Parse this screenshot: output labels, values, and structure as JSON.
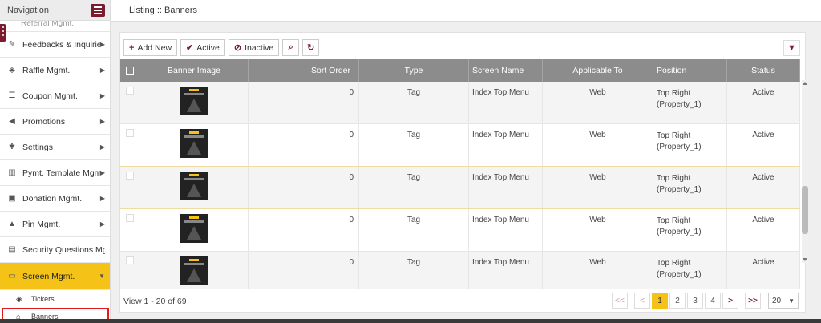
{
  "sidebar": {
    "title": "Navigation",
    "cut_item": "Referral Mgmt.",
    "items": [
      {
        "label": "Feedbacks & Inquiries",
        "icon": "edit-icon"
      },
      {
        "label": "Raffle Mgmt.",
        "icon": "ticket-icon"
      },
      {
        "label": "Coupon Mgmt.",
        "icon": "list-icon"
      },
      {
        "label": "Promotions",
        "icon": "bullhorn-icon"
      },
      {
        "label": "Settings",
        "icon": "gear-icon"
      },
      {
        "label": "Pymt. Template Mgmt.",
        "icon": "bank-icon"
      },
      {
        "label": "Donation Mgmt.",
        "icon": "money-icon"
      },
      {
        "label": "Pin Mgmt.",
        "icon": "lock-icon"
      },
      {
        "label": "Security Questions Mgmt.",
        "icon": "document-icon"
      },
      {
        "label": "Screen Mgmt.",
        "icon": "monitor-icon"
      }
    ],
    "subitems": [
      {
        "label": "Tickers",
        "icon": "ticker-icon"
      },
      {
        "label": "Banners",
        "icon": "banner-icon"
      }
    ]
  },
  "header": {
    "breadcrumb": "Listing :: Banners"
  },
  "toolbar": {
    "add_new": "Add New",
    "active": "Active",
    "inactive": "Inactive"
  },
  "table": {
    "columns": [
      "Banner Image",
      "Sort Order",
      "Type",
      "Screen Name",
      "Applicable To",
      "Position",
      "Status"
    ],
    "rows": [
      {
        "sort_order": "0",
        "type": "Tag",
        "screen_name": "Index Top Menu",
        "applicable_to": "Web",
        "position_line1": "Top Right",
        "position_line2": "(Property_1)",
        "status": "Active"
      },
      {
        "sort_order": "0",
        "type": "Tag",
        "screen_name": "Index Top Menu",
        "applicable_to": "Web",
        "position_line1": "Top Right",
        "position_line2": "(Property_1)",
        "status": "Active"
      },
      {
        "sort_order": "0",
        "type": "Tag",
        "screen_name": "Index Top Menu",
        "applicable_to": "Web",
        "position_line1": "Top Right",
        "position_line2": "(Property_1)",
        "status": "Active"
      },
      {
        "sort_order": "0",
        "type": "Tag",
        "screen_name": "Index Top Menu",
        "applicable_to": "Web",
        "position_line1": "Top Right",
        "position_line2": "(Property_1)",
        "status": "Active"
      },
      {
        "sort_order": "0",
        "type": "Tag",
        "screen_name": "Index Top Menu",
        "applicable_to": "Web",
        "position_line1": "Top Right",
        "position_line2": "(Property_1)",
        "status": "Active"
      }
    ]
  },
  "footer": {
    "view_text": "View 1 - 20 of 69",
    "first": "<<",
    "prev": "<",
    "pages": [
      "1",
      "2",
      "3",
      "4"
    ],
    "next": ">",
    "last": ">>",
    "page_size": "20"
  },
  "colors": {
    "accent": "#7b1c2e",
    "highlight": "#f5c318",
    "header_bg": "#8c8c8c"
  }
}
